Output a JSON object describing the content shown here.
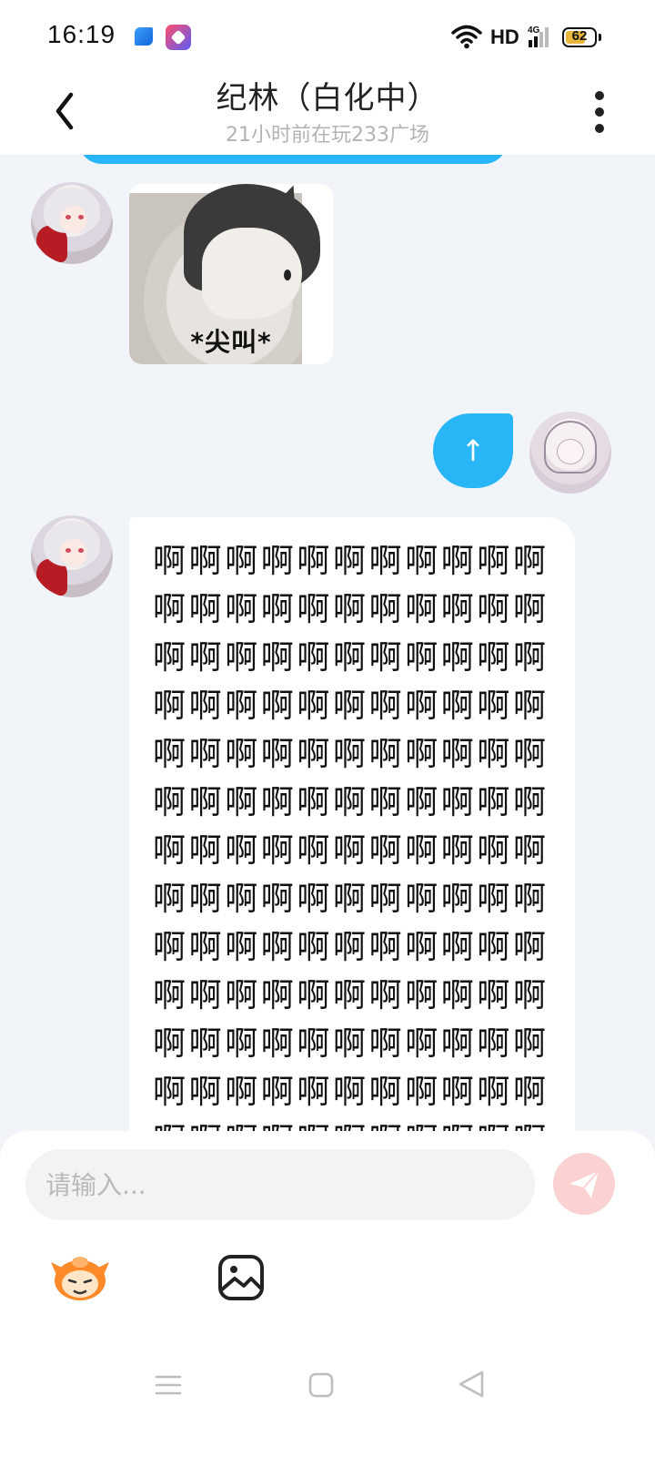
{
  "status_bar": {
    "time": "16:19",
    "network_label": "HD",
    "signal_label": "4G",
    "battery": "62",
    "icons": [
      "app-notification-icon",
      "app-notification-icon-2",
      "wifi-icon",
      "signal-icon",
      "battery-icon"
    ]
  },
  "header": {
    "title": "纪林（白化中）",
    "subtitle": "21小时前在玩233广场",
    "back_icon": "chevron-left-icon",
    "more_icon": "more-vertical-icon"
  },
  "messages": [
    {
      "side": "received",
      "type": "sticker",
      "caption": "*尖叫*"
    },
    {
      "side": "sent",
      "type": "text",
      "text": "↑"
    },
    {
      "side": "received",
      "type": "text",
      "text": "啊啊啊啊啊啊啊啊啊啊啊啊啊啊啊啊啊啊啊啊啊啊啊啊啊啊啊啊啊啊啊啊啊啊啊啊啊啊啊啊啊啊啊啊啊啊啊啊啊啊啊啊啊啊啊啊啊啊啊啊啊啊啊啊啊啊啊啊啊啊啊啊啊啊啊啊啊啊啊啊啊啊啊啊啊啊啊啊啊啊啊啊啊啊啊啊啊啊啊啊啊啊啊啊啊啊啊啊啊啊啊啊啊啊啊啊啊啊啊啊啊啊啊啊啊啊啊啊啊啊啊啊啊啊啊啊啊啊啊啊啊啊啊啊啊啊啊啊啊"
    }
  ],
  "composer": {
    "placeholder": "请输入...",
    "send_icon": "send-icon",
    "emoji_icon": "emoji-mascot-icon",
    "image_icon": "image-icon"
  },
  "colors": {
    "accent_blue": "#29b6f6",
    "send_disabled": "#fbd1d1",
    "background": "#f1f4f8"
  }
}
